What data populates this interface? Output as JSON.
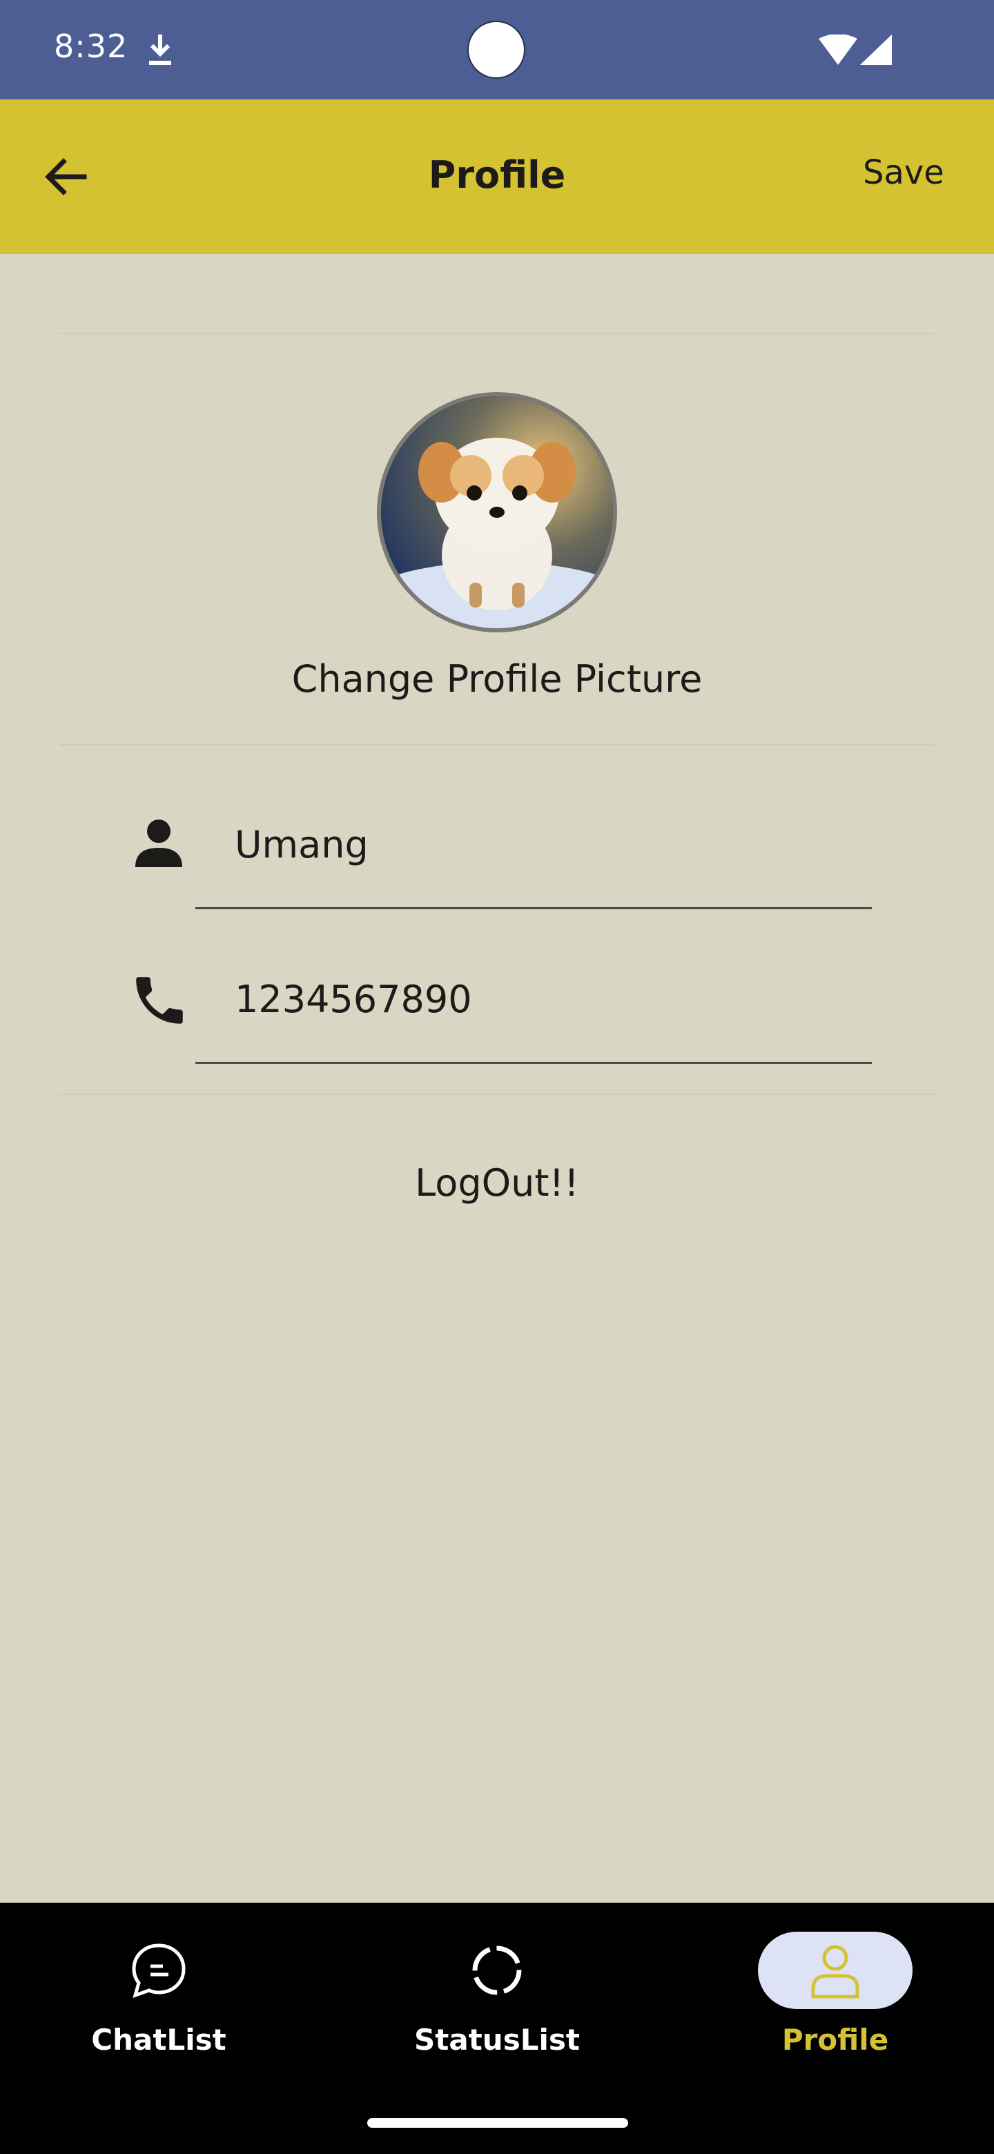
{
  "status_bar": {
    "time": "8:32",
    "icons": [
      "download-icon",
      "wifi-icon",
      "cellular-signal-icon"
    ]
  },
  "app_bar": {
    "title": "Profile",
    "save_label": "Save",
    "back_icon": "arrow-back-icon"
  },
  "profile": {
    "avatar_alt": "puppy-avatar",
    "change_picture_label": "Change Profile Picture",
    "name_value": "Umang",
    "phone_value": "1234567890",
    "logout_label": "LogOut!!"
  },
  "bottom_nav": {
    "items": [
      {
        "label": "ChatList",
        "icon": "chat-bubble-icon"
      },
      {
        "label": "StatusList",
        "icon": "status-ring-icon"
      },
      {
        "label": "Profile",
        "icon": "person-icon",
        "active": true
      }
    ]
  },
  "colors": {
    "status_bar": "#4c5e94",
    "app_bar": "#d4c232",
    "background": "#d9d6c3",
    "nav_bg": "#000000",
    "active_label": "#d4c232",
    "active_pill": "#dde2f5"
  }
}
